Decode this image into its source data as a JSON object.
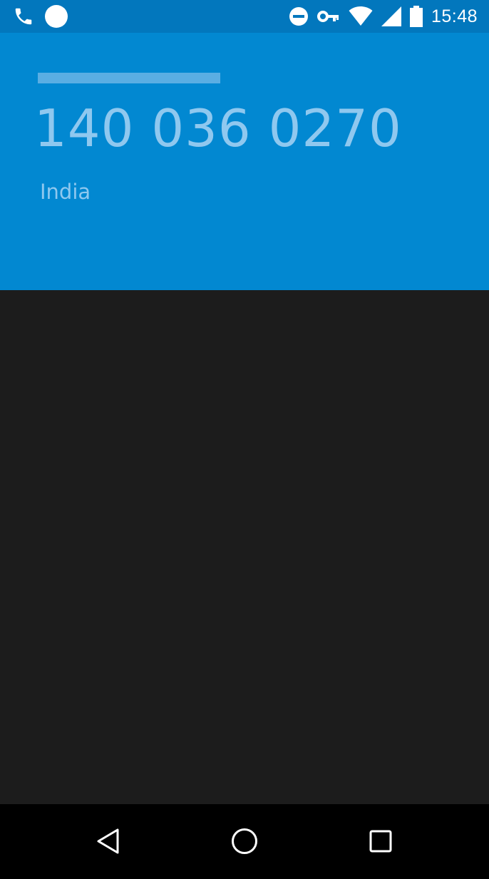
{
  "status_bar": {
    "time": "15:48",
    "left_icons": [
      "phone-call-icon",
      "notification-dot-icon"
    ],
    "right_icons": [
      "do-not-disturb-icon",
      "vpn-key-icon",
      "wifi-icon",
      "cellular-signal-icon",
      "battery-icon"
    ]
  },
  "call": {
    "phone_number": "140 036 0270",
    "location": "India"
  },
  "nav_bar": {
    "buttons": [
      "back-icon",
      "home-icon",
      "recents-icon"
    ]
  },
  "colors": {
    "status_bar": "#0277bd",
    "header": "#0288d1",
    "body": "#1c1c1c",
    "nav_bar": "#000000",
    "number_text": "#8fc8ef"
  }
}
